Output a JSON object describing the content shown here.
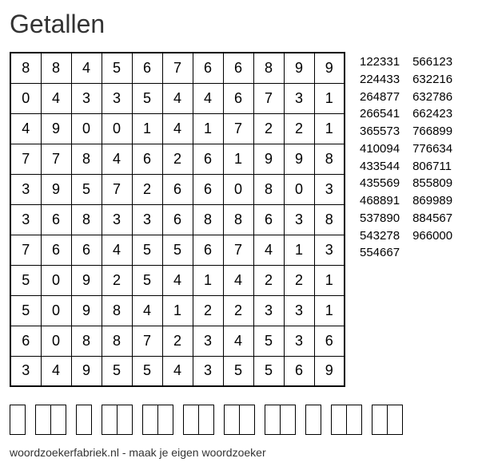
{
  "title": "Getallen",
  "grid": [
    [
      "8",
      "8",
      "4",
      "5",
      "6",
      "7",
      "6",
      "6",
      "8",
      "9",
      "9"
    ],
    [
      "0",
      "4",
      "3",
      "3",
      "5",
      "4",
      "4",
      "6",
      "7",
      "3",
      "1"
    ],
    [
      "4",
      "9",
      "0",
      "0",
      "1",
      "4",
      "1",
      "7",
      "2",
      "2",
      "1"
    ],
    [
      "7",
      "7",
      "8",
      "4",
      "6",
      "2",
      "6",
      "1",
      "9",
      "9",
      "8"
    ],
    [
      "3",
      "9",
      "5",
      "7",
      "2",
      "6",
      "6",
      "0",
      "8",
      "0",
      "3"
    ],
    [
      "3",
      "6",
      "8",
      "3",
      "3",
      "6",
      "8",
      "8",
      "6",
      "3",
      "8"
    ],
    [
      "7",
      "6",
      "6",
      "4",
      "5",
      "5",
      "6",
      "7",
      "4",
      "1",
      "3"
    ],
    [
      "5",
      "0",
      "9",
      "2",
      "5",
      "4",
      "1",
      "4",
      "2",
      "2",
      "1"
    ],
    [
      "5",
      "0",
      "9",
      "8",
      "4",
      "1",
      "2",
      "2",
      "3",
      "3",
      "1"
    ],
    [
      "6",
      "0",
      "8",
      "8",
      "7",
      "2",
      "3",
      "4",
      "5",
      "3",
      "6"
    ],
    [
      "3",
      "4",
      "9",
      "5",
      "5",
      "4",
      "3",
      "5",
      "5",
      "6",
      "9"
    ]
  ],
  "words_col1": [
    "122331",
    "224433",
    "264877",
    "266541",
    "365573",
    "410094",
    "433544",
    "435569",
    "468891",
    "537890",
    "543278",
    "554667"
  ],
  "words_col2": [
    "566123",
    "632216",
    "632786",
    "662423",
    "766899",
    "776634",
    "806711",
    "855809",
    "869989",
    "884567",
    "966000"
  ],
  "answer_boxes": [
    1,
    2,
    1,
    2,
    2,
    2,
    2,
    2,
    1,
    2,
    2
  ],
  "footer": "woordzoekerfabriek.nl - maak je eigen woordzoeker"
}
